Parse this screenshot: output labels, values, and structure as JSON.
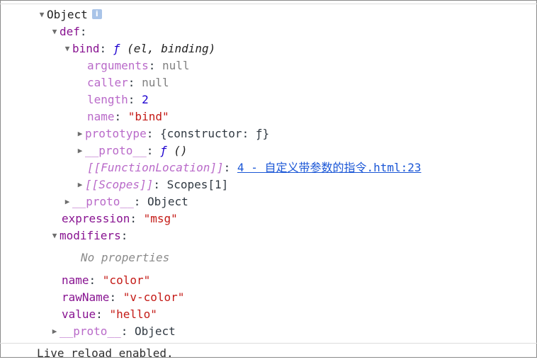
{
  "tree": {
    "root": {
      "label": "Object",
      "info_icon": "i"
    },
    "def": {
      "key": "def"
    },
    "bind": {
      "key": "bind",
      "value_prefix": "ƒ",
      "value_sig": "(el, binding)"
    },
    "arguments": {
      "key": "arguments",
      "value": "null"
    },
    "caller": {
      "key": "caller",
      "value": "null"
    },
    "length": {
      "key": "length",
      "value": "2"
    },
    "name_fn": {
      "key": "name",
      "value": "\"bind\""
    },
    "prototype": {
      "key": "prototype",
      "value": "{constructor: ƒ}"
    },
    "proto_fn": {
      "key": "__proto__",
      "value_prefix": "ƒ",
      "value_sig": "()"
    },
    "function_location": {
      "key": "[[FunctionLocation]]",
      "link": "4 - 自定义带参数的指令.html:23"
    },
    "scopes": {
      "key": "[[Scopes]]",
      "value": "Scopes[1]"
    },
    "proto_def": {
      "key": "__proto__",
      "value": "Object"
    },
    "expression": {
      "key": "expression",
      "value": "\"msg\""
    },
    "modifiers": {
      "key": "modifiers",
      "empty_text": "No properties"
    },
    "name": {
      "key": "name",
      "value": "\"color\""
    },
    "rawName": {
      "key": "rawName",
      "value": "\"v-color\""
    },
    "value": {
      "key": "value",
      "value": "\"hello\""
    },
    "proto_root": {
      "key": "__proto__",
      "value": "Object"
    }
  },
  "status": {
    "text": "Live reload enabled."
  },
  "icons": {
    "expanded": "triangle-down-icon",
    "collapsed": "triangle-right-icon",
    "info": "info-icon"
  }
}
